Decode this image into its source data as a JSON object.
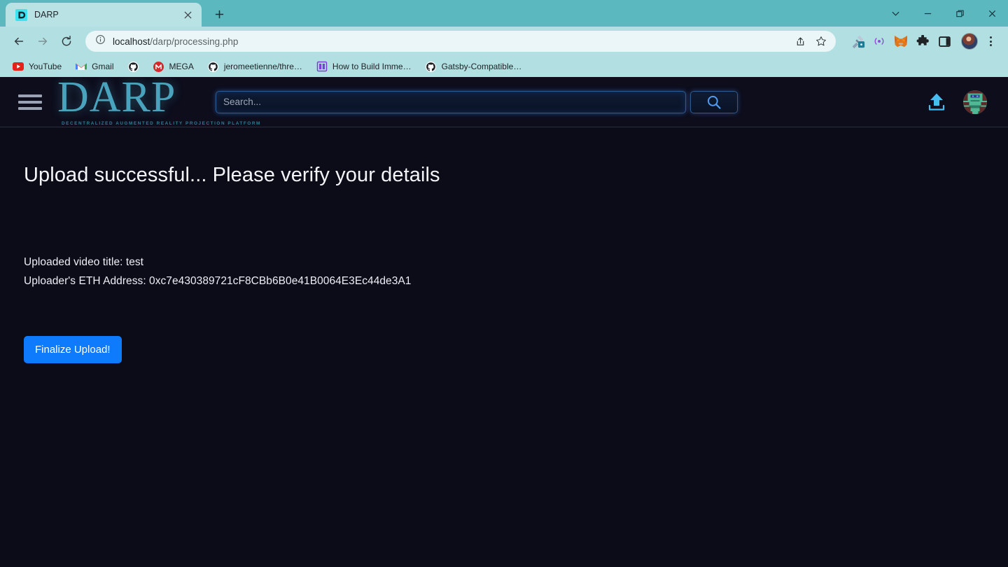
{
  "browser": {
    "tab": {
      "title": "DARP",
      "favicon_icon": "darp-favicon",
      "close_icon": "close-icon"
    },
    "newtab_icon": "plus-icon",
    "window_controls": [
      {
        "name": "tab-search",
        "icon": "chevron-down-icon",
        "glyph": "⌄"
      },
      {
        "name": "minimize",
        "icon": "minimize-icon",
        "glyph": "—"
      },
      {
        "name": "maximize",
        "icon": "restore-icon",
        "glyph": "❐"
      },
      {
        "name": "close",
        "icon": "close-icon",
        "glyph": "✕"
      }
    ],
    "nav": {
      "back_icon": "back-arrow-icon",
      "forward_icon": "forward-arrow-icon",
      "reload_icon": "reload-icon"
    },
    "omnibox": {
      "info_icon": "site-info-icon",
      "url_host": "localhost",
      "url_path": "/darp/processing.php",
      "share_icon": "share-icon",
      "bookmark_icon": "star-icon"
    },
    "extensions": [
      {
        "name": "eyedropper-extension",
        "icon": "eyedropper-icon"
      },
      {
        "name": "broadcast-extension",
        "icon": "broadcast-icon"
      },
      {
        "name": "metamask-extension",
        "icon": "fox-icon"
      },
      {
        "name": "extensions-menu",
        "icon": "puzzle-icon"
      },
      {
        "name": "side-panel",
        "icon": "side-panel-icon"
      }
    ],
    "profile_icon": "profile-avatar",
    "menu_icon": "kebab-menu-icon",
    "bookmarks": [
      {
        "label": "YouTube",
        "icon": "youtube-icon"
      },
      {
        "label": "Gmail",
        "icon": "gmail-icon"
      },
      {
        "label": "",
        "icon": "github-icon"
      },
      {
        "label": "MEGA",
        "icon": "mega-icon"
      },
      {
        "label": "jeromeetienne/thre…",
        "icon": "github-icon"
      },
      {
        "label": "How to Build Imme…",
        "icon": "book-icon"
      },
      {
        "label": "Gatsby-Compatible…",
        "icon": "github-icon"
      }
    ]
  },
  "site": {
    "menu_icon": "hamburger-menu-icon",
    "logo": {
      "word": "DARP",
      "tagline": "DECENTRALIZED AUGMENTED REALITY PROJECTION PLATFORM"
    },
    "search": {
      "placeholder": "Search...",
      "value": "",
      "button_icon": "search-icon"
    },
    "upload_icon": "upload-icon",
    "avatar_icon": "user-avatar"
  },
  "main": {
    "headline": "Upload successful... Please verify your details",
    "video_title_line": "Uploaded video title: test",
    "eth_address_line": "Uploader's ETH Address: 0xc7e430389721cF8CBb6B0e41B0064E3Ec44de3A1",
    "finalize_label": "Finalize Upload!"
  },
  "colors": {
    "chrome_accent": "#5cb8bf",
    "toolbar": "#b2dfe2",
    "page_background": "#0c0c18",
    "brand": "#4aa3bd",
    "button_primary": "#0d7bfc"
  }
}
